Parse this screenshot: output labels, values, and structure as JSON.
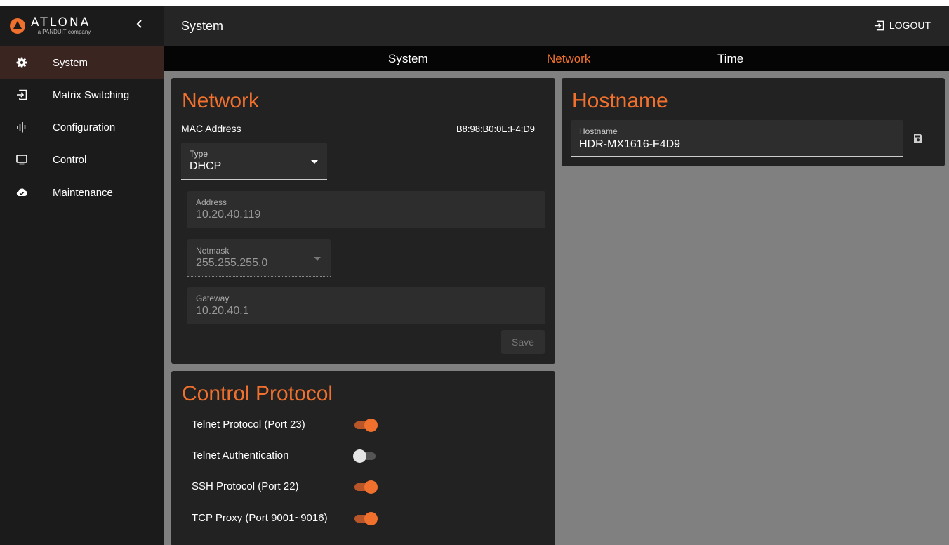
{
  "brand": {
    "logo_word": "ATLONA",
    "logo_sub": "a PANDUIT company",
    "collapse_icon": "chevron-left-icon"
  },
  "sidebar": {
    "items": [
      {
        "label": "System",
        "icon": "gear-icon",
        "active": true
      },
      {
        "label": "Matrix Switching",
        "icon": "input-icon",
        "active": false
      },
      {
        "label": "Configuration",
        "icon": "equalizer-icon",
        "active": false
      },
      {
        "label": "Control",
        "icon": "monitor-icon",
        "active": false
      },
      {
        "label": "Maintenance",
        "icon": "cloud-check-icon",
        "active": false
      }
    ]
  },
  "header": {
    "title": "System",
    "logout_label": "LOGOUT"
  },
  "tabs": [
    {
      "label": "System",
      "active": false
    },
    {
      "label": "Network",
      "active": true
    },
    {
      "label": "Time",
      "active": false
    }
  ],
  "network": {
    "title": "Network",
    "mac_label": "MAC Address",
    "mac_value": "B8:98:B0:0E:F4:D9",
    "type": {
      "label": "Type",
      "value": "DHCP"
    },
    "address": {
      "label": "Address",
      "value": "10.20.40.119"
    },
    "netmask": {
      "label": "Netmask",
      "value": "255.255.255.0"
    },
    "gateway": {
      "label": "Gateway",
      "value": "10.20.40.1"
    },
    "save_label": "Save"
  },
  "hostname": {
    "title": "Hostname",
    "field_label": "Hostname",
    "field_value": "HDR-MX1616-F4D9"
  },
  "control_protocol": {
    "title": "Control Protocol",
    "toggles": [
      {
        "label": "Telnet Protocol (Port 23)",
        "on": true
      },
      {
        "label": "Telnet Authentication",
        "on": false
      },
      {
        "label": "SSH Protocol (Port 22)",
        "on": true
      },
      {
        "label": "TCP Proxy (Port 9001~9016)",
        "on": true
      }
    ]
  },
  "colors": {
    "accent": "#f0702d",
    "sidebar_bg": "#1b1b1b",
    "active_nav_bg": "#3b2520",
    "card_bg": "#222222",
    "page_bg": "#808080"
  }
}
